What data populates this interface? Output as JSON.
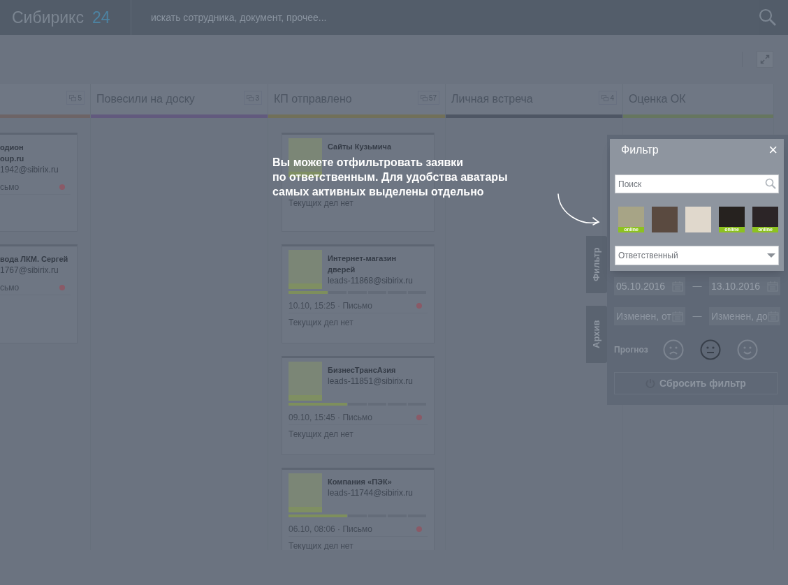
{
  "header": {
    "logo": "Сибирикс",
    "logo_number": "24",
    "search_placeholder": "искать сотрудника, документ, прочее..."
  },
  "columns": [
    {
      "count": "5",
      "color": "#6d6466",
      "cards": [
        {
          "title_lines": [
            "одион",
            "oup.ru"
          ],
          "email": "1942@sibirix.ru",
          "activity": "сьмо"
        },
        {
          "title_lines": [
            "вода ЛКМ. Сергей"
          ],
          "email": "1767@sibirix.ru",
          "activity": "сьмо"
        }
      ]
    },
    {
      "title": "Повесили на доску",
      "count": "3",
      "color": "#625a7e"
    },
    {
      "title": "КП отправлено",
      "count": "57",
      "color": "#717059",
      "cards": [
        {
          "title_lines": [
            "Сайты Кузьмича"
          ],
          "online": true,
          "todo": "Текущих дел нет"
        },
        {
          "title_lines": [
            "Интернет-магазин",
            "дверей"
          ],
          "online": true,
          "email": "leads-11868@sibirix.ru",
          "level": 0.2857,
          "activity": "10.10, 15:25 · Письмо",
          "todo": "Текущих дел нет"
        },
        {
          "title_lines": [
            "БизнесТрансАзия"
          ],
          "online": true,
          "email": "leads-11851@sibirix.ru",
          "level": 0.4286,
          "activity": "09.10, 15:45 · Письмо",
          "todo": "Текущих дел нет"
        },
        {
          "title_lines": [
            "Компания «ПЭК»"
          ],
          "online": true,
          "email": "leads-11744@sibirix.ru",
          "level": 0.4286,
          "activity": "06.10, 08:06 · Письмо",
          "todo": "Текущих дел нет"
        }
      ]
    },
    {
      "title": "Личная встреча",
      "count": "4",
      "color": "#4e5664"
    },
    {
      "title": "Оценка ОК",
      "color": "#66765f"
    }
  ],
  "hint": {
    "lines": [
      "Вы можете отфильтровать заявки",
      "по ответственным. Для удобства аватары",
      "самых активных выделены отдельно"
    ]
  },
  "side_tabs": [
    {
      "label": "Фильтр"
    },
    {
      "label": "Архив"
    }
  ],
  "filter_panel": {
    "date_from": "05.10.2016",
    "date_to": "13.10.2016",
    "changed_from_placeholder": "Изменен, от",
    "changed_to_placeholder": "Изменен, до",
    "dash": "—",
    "forecast_label": "Прогноз",
    "forecast": [
      {
        "kind": "sad",
        "selected": false
      },
      {
        "kind": "neutral",
        "selected": true
      },
      {
        "kind": "happy",
        "selected": false
      }
    ],
    "reset_button": "Сбросить фильтр"
  },
  "filter_popup": {
    "title": "Фильтр",
    "close": "×",
    "search_placeholder": "Поиск",
    "avatars": [
      {
        "online": true,
        "online_label": "online"
      },
      {
        "online": false
      },
      {
        "online": false
      },
      {
        "online": true,
        "online_label": "online"
      },
      {
        "online": true,
        "online_label": "online"
      }
    ],
    "responsible_placeholder": "Ответственный"
  }
}
